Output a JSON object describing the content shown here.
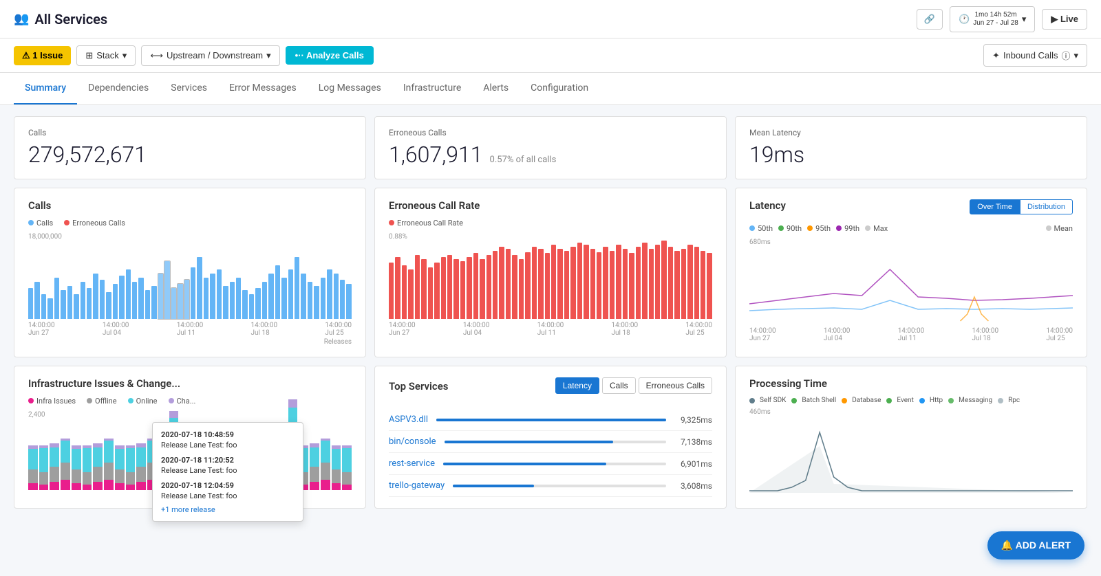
{
  "header": {
    "title": "All Services",
    "icon": "👥",
    "link_btn": "🔗",
    "time_range": "1mo 14h 52m\nJun 27 - Jul 28",
    "time_range_line1": "1mo 14h 52m",
    "time_range_line2": "Jun 27 - Jul 28",
    "live_label": "▶ Live"
  },
  "toolbar": {
    "issue_label": "⚠ 1 Issue",
    "stack_label": "Stack",
    "upstream_label": "Upstream / Downstream",
    "analyze_label": "•·· Analyze Calls",
    "inbound_label": "Inbound Calls"
  },
  "nav": {
    "tabs": [
      "Summary",
      "Dependencies",
      "Services",
      "Error Messages",
      "Log Messages",
      "Infrastructure",
      "Alerts",
      "Configuration"
    ],
    "active": "Summary"
  },
  "stats": {
    "calls_label": "Calls",
    "calls_value": "279,572,671",
    "erroneous_label": "Erroneous Calls",
    "erroneous_value": "1,607,911",
    "erroneous_sub": "0.57% of all calls",
    "latency_label": "Mean Latency",
    "latency_value": "19ms"
  },
  "calls_chart": {
    "title": "Calls",
    "legend_calls": "Calls",
    "legend_erroneous": "Erroneous Calls",
    "y_label": "18,000,000",
    "dates": [
      "14:00:00\nJun 27",
      "14:00:00\nJul 04",
      "14:00:00\nJul 11",
      "14:00:00\nJul 18",
      "14:00:00\nJul 25"
    ],
    "releases_label": "Releases"
  },
  "erroneous_chart": {
    "title": "Erroneous Call Rate",
    "legend": "Erroneous Call Rate",
    "y_label": "0.88%",
    "dates": [
      "14:00:00\nJun 27",
      "14:00:00\nJul 04",
      "14:00:00\nJul 11",
      "14:00:00\nJul 18",
      "14:00:00\nJul 25"
    ]
  },
  "latency_chart": {
    "title": "Latency",
    "btn_over_time": "Over Time",
    "btn_distribution": "Distribution",
    "legend_50th": "50th",
    "legend_90th": "90th",
    "legend_95th": "95th",
    "legend_99th": "99th",
    "legend_max": "Max",
    "legend_mean": "Mean",
    "y_label": "680ms",
    "dates": [
      "14:00:00\nJun 27",
      "14:00:00\nJul 04",
      "14:00:00\nJul 11",
      "14:00:00\nJul 18",
      "14:00:00\nJul 25"
    ]
  },
  "infra_chart": {
    "title": "Infrastructure Issues & Change...",
    "legend_infra": "Infra Issues",
    "legend_offline": "Offline",
    "legend_online": "Online",
    "legend_cha": "Cha...",
    "y_label": "2,400"
  },
  "top_services": {
    "title": "Top Services",
    "btn_latency": "Latency",
    "btn_calls": "Calls",
    "btn_erroneous": "Erroneous Calls",
    "services": [
      {
        "name": "ASPV3.dll",
        "value": "9,325ms",
        "pct": 100
      },
      {
        "name": "bin/console",
        "value": "7,138ms",
        "pct": 76
      },
      {
        "name": "rest-service",
        "value": "6,901ms",
        "pct": 73
      },
      {
        "name": "trello-gateway",
        "value": "3,608ms",
        "pct": 38
      }
    ]
  },
  "processing_chart": {
    "title": "Processing Time",
    "legend_self": "Self SDK",
    "legend_batch": "Batch Shell",
    "legend_database": "Database",
    "legend_event": "Event",
    "legend_http": "Http",
    "legend_messaging": "Messaging",
    "legend_rpc": "Rpc",
    "y_label": "460ms"
  },
  "tooltip": {
    "item1_date": "2020-07-18 10:48:59",
    "item1_text": "Release Lane Test: foo",
    "item2_date": "2020-07-18 11:20:52",
    "item2_text": "Release Lane Test: foo",
    "item3_date": "2020-07-18 12:04:59",
    "item3_text": "Release Lane Test: foo",
    "more_label": "+1 more release"
  },
  "add_alert": "🔔 ADD ALERT",
  "colors": {
    "blue": "#1976d2",
    "light_blue": "#64b5f6",
    "red": "#ef5350",
    "teal": "#00b8d4",
    "yellow": "#f5c400",
    "green": "#4caf50",
    "orange": "#ff9800",
    "purple": "#9c27b0",
    "gray": "#9e9e9e"
  }
}
